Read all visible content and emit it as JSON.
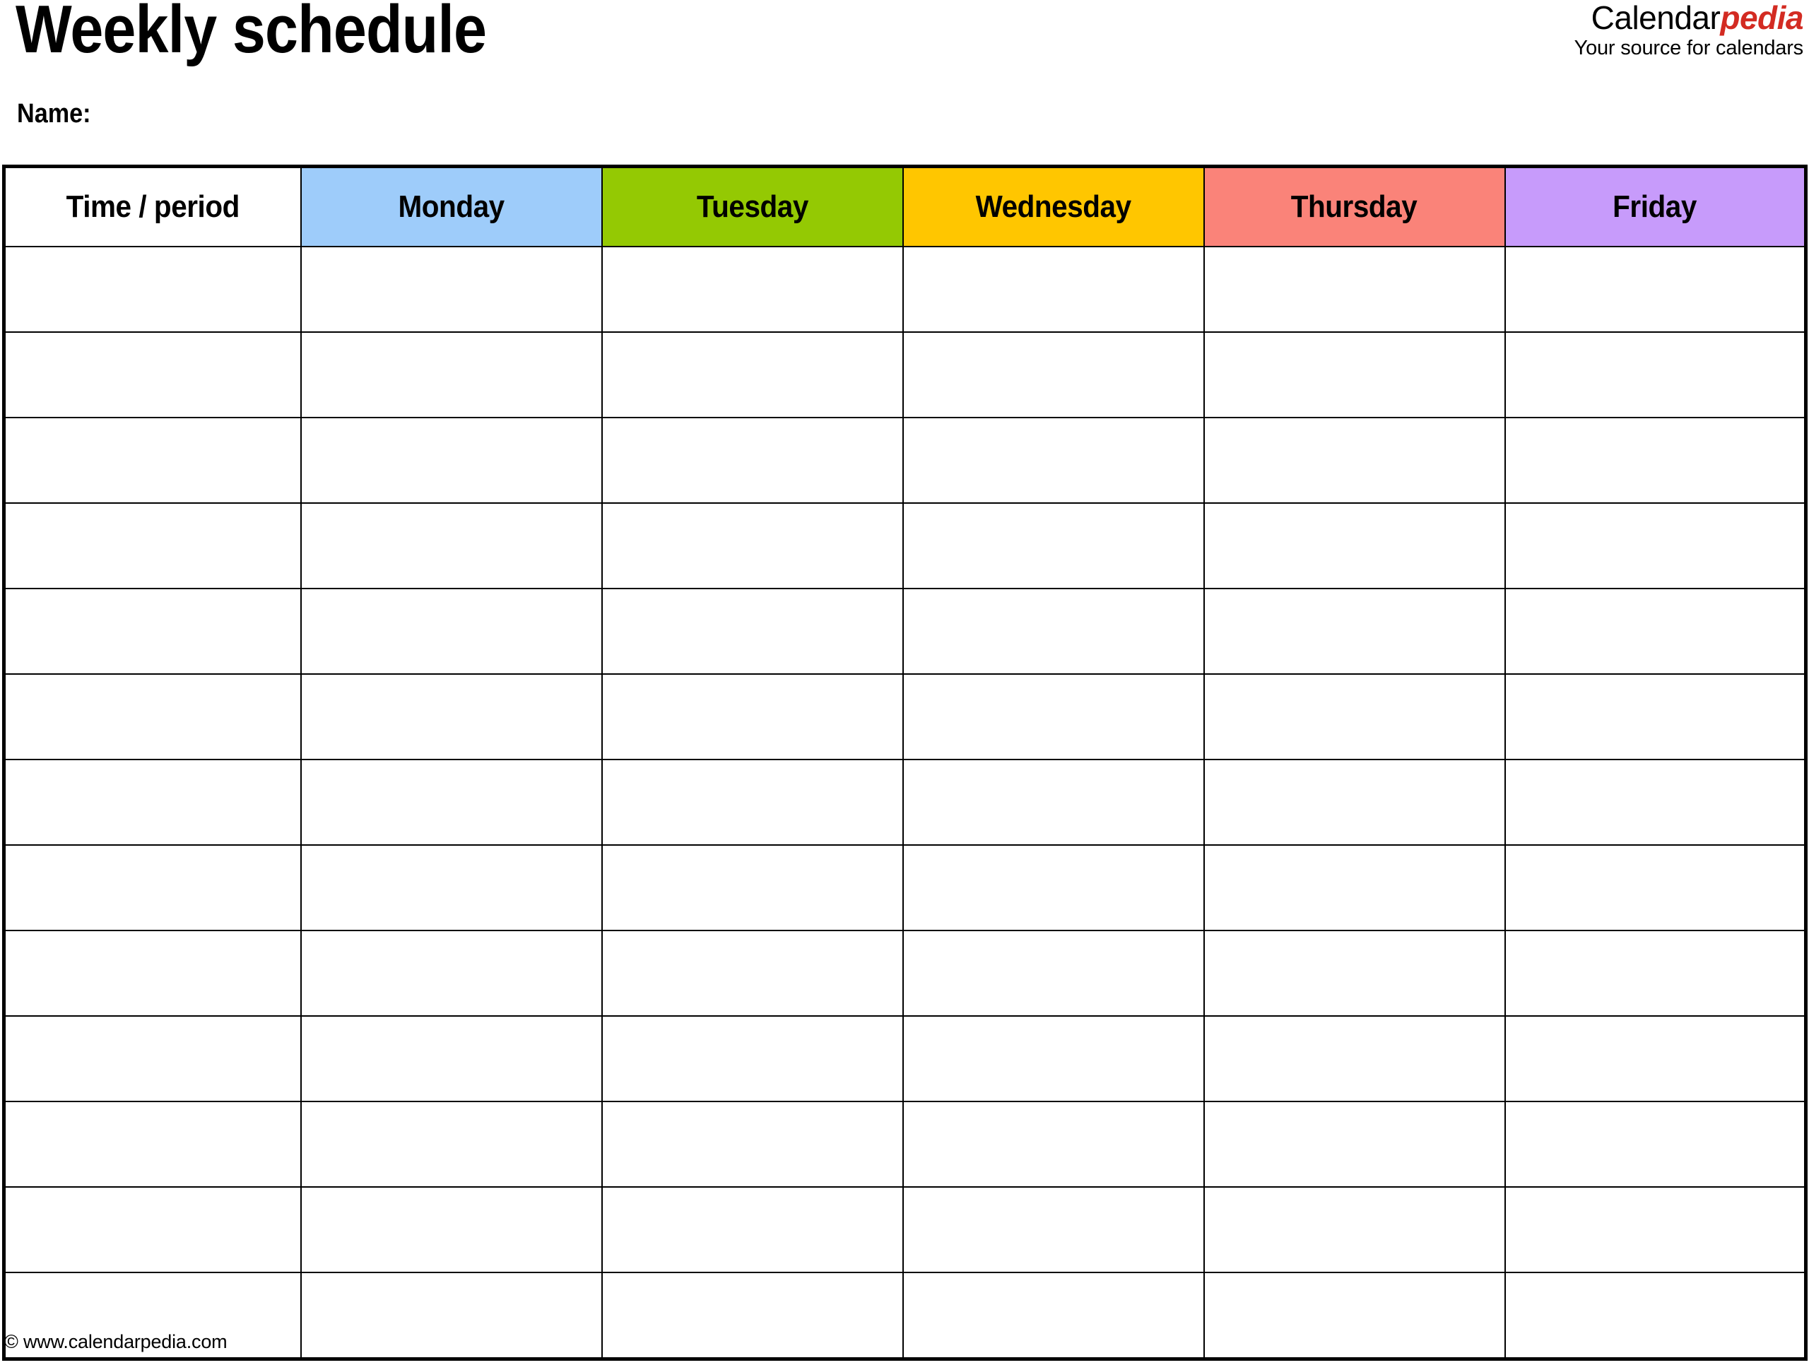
{
  "document": {
    "title": "Weekly schedule",
    "name_label": "Name:"
  },
  "brand": {
    "word_primary": "Calendar",
    "word_accent": "pedia",
    "tagline": "Your source for calendars",
    "accent_color": "#D32B22"
  },
  "table": {
    "columns": [
      {
        "key": "time",
        "label": "Time / period",
        "color": "#FFFFFF"
      },
      {
        "key": "monday",
        "label": "Monday",
        "color": "#9ECCFA"
      },
      {
        "key": "tuesday",
        "label": "Tuesday",
        "color": "#94C903"
      },
      {
        "key": "wednesday",
        "label": "Wednesday",
        "color": "#FFC600"
      },
      {
        "key": "thursday",
        "label": "Thursday",
        "color": "#FA8379"
      },
      {
        "key": "friday",
        "label": "Friday",
        "color": "#C79BFB"
      }
    ],
    "row_count": 13,
    "rows": [
      {
        "time": "",
        "monday": "",
        "tuesday": "",
        "wednesday": "",
        "thursday": "",
        "friday": ""
      },
      {
        "time": "",
        "monday": "",
        "tuesday": "",
        "wednesday": "",
        "thursday": "",
        "friday": ""
      },
      {
        "time": "",
        "monday": "",
        "tuesday": "",
        "wednesday": "",
        "thursday": "",
        "friday": ""
      },
      {
        "time": "",
        "monday": "",
        "tuesday": "",
        "wednesday": "",
        "thursday": "",
        "friday": ""
      },
      {
        "time": "",
        "monday": "",
        "tuesday": "",
        "wednesday": "",
        "thursday": "",
        "friday": ""
      },
      {
        "time": "",
        "monday": "",
        "tuesday": "",
        "wednesday": "",
        "thursday": "",
        "friday": ""
      },
      {
        "time": "",
        "monday": "",
        "tuesday": "",
        "wednesday": "",
        "thursday": "",
        "friday": ""
      },
      {
        "time": "",
        "monday": "",
        "tuesday": "",
        "wednesday": "",
        "thursday": "",
        "friday": ""
      },
      {
        "time": "",
        "monday": "",
        "tuesday": "",
        "wednesday": "",
        "thursday": "",
        "friday": ""
      },
      {
        "time": "",
        "monday": "",
        "tuesday": "",
        "wednesday": "",
        "thursday": "",
        "friday": ""
      },
      {
        "time": "",
        "monday": "",
        "tuesday": "",
        "wednesday": "",
        "thursday": "",
        "friday": ""
      },
      {
        "time": "",
        "monday": "",
        "tuesday": "",
        "wednesday": "",
        "thursday": "",
        "friday": ""
      },
      {
        "time": "",
        "monday": "",
        "tuesday": "",
        "wednesday": "",
        "thursday": "",
        "friday": ""
      }
    ]
  },
  "footer": {
    "copyright": "© www.calendarpedia.com"
  }
}
